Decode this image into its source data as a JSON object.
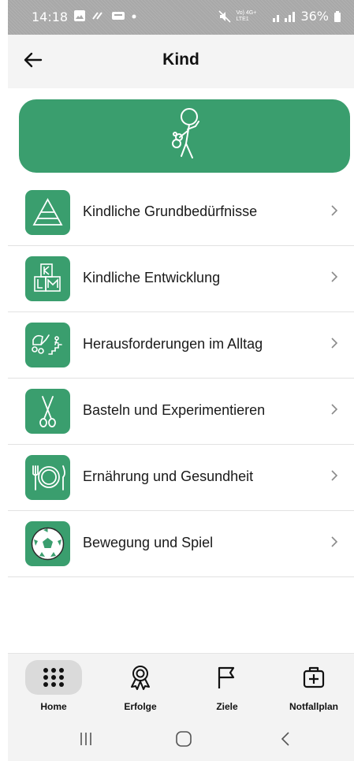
{
  "status_bar": {
    "time": "14:18",
    "battery": "36%",
    "network_text": "Vo) 4G+ LTE1"
  },
  "header": {
    "title": "Kind",
    "back_icon": "arrow-left-icon"
  },
  "banner": {
    "icon": "child-with-teddy-icon",
    "color": "#3a9e6e"
  },
  "menu": {
    "items": [
      {
        "label": "Kindliche Grundbedürfnisse",
        "icon": "pyramid-icon"
      },
      {
        "label": "Kindliche Entwicklung",
        "icon": "building-blocks-icon"
      },
      {
        "label": "Herausforderungen im Alltag",
        "icon": "stroller-stairs-icon"
      },
      {
        "label": "Basteln und Experimentieren",
        "icon": "scissors-icon"
      },
      {
        "label": "Ernährung und Gesundheit",
        "icon": "plate-cutlery-icon"
      },
      {
        "label": "Bewegung und Spiel",
        "icon": "soccer-ball-icon"
      }
    ]
  },
  "bottom_nav": {
    "items": [
      {
        "label": "Home",
        "icon": "grid-dots-icon",
        "active": true
      },
      {
        "label": "Erfolge",
        "icon": "award-ribbon-icon",
        "active": false
      },
      {
        "label": "Ziele",
        "icon": "flag-icon",
        "active": false
      },
      {
        "label": "Notfallplan",
        "icon": "first-aid-kit-icon",
        "active": false
      }
    ]
  },
  "colors": {
    "accent": "#3a9e6e",
    "header_bg": "#f4f4f4",
    "nav_bg": "#f3f3f3"
  }
}
